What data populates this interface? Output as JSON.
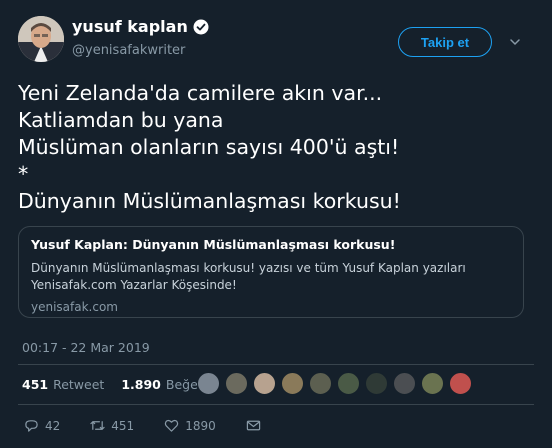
{
  "author": {
    "display_name": "yusuf kaplan",
    "handle": "@yenisafakwriter",
    "verified": true
  },
  "follow_button": {
    "label": "Takip et"
  },
  "tweet": {
    "text_lines": [
      "Yeni Zelanda'da camilere akın var...",
      "Katliamdan bu yana",
      "Müslüman olanların sayısı 400'ü aştı!",
      "*",
      "Dünyanın Müslümanlaşması korkusu!"
    ]
  },
  "link_card": {
    "title": "Yusuf Kaplan: Dünyanın Müslümanlaşması korkusu!",
    "description_lines": [
      "Dünyanın Müslümanlaşması korkusu! yazısı ve tüm Yusuf Kaplan yazıları",
      "Yenisafak.com Yazarlar Köşesinde!"
    ],
    "domain": "yenisafak.com"
  },
  "timestamp": "00:17 - 22 Mar 2019",
  "stats": {
    "retweets_count": "451",
    "retweets_label": "Retweet",
    "likes_count": "1.890",
    "likes_label": "Beğeni"
  },
  "likers": [
    {
      "color": "#7a8591",
      "icon": "avatar-icon"
    },
    {
      "color": "#6b6a5e",
      "icon": "avatar-icon"
    },
    {
      "color": "#b7a28f",
      "icon": "avatar-icon"
    },
    {
      "color": "#8a7a5a",
      "icon": "avatar-icon"
    },
    {
      "color": "#5c5f50",
      "icon": "avatar-icon"
    },
    {
      "color": "#4a5a46",
      "icon": "avatar-icon"
    },
    {
      "color": "#2f3a36",
      "icon": "avatar-icon"
    },
    {
      "color": "#4b4e52",
      "icon": "avatar-icon"
    },
    {
      "color": "#6a7350",
      "icon": "avatar-icon"
    },
    {
      "color": "#c0504d",
      "icon": "avatar-icon"
    }
  ],
  "actions": {
    "reply_count": "42",
    "retweet_count": "451",
    "like_count": "1890"
  },
  "colors": {
    "background": "#15202b",
    "accent": "#1da1f2",
    "muted_text": "#8899a6",
    "border": "#38444d"
  }
}
